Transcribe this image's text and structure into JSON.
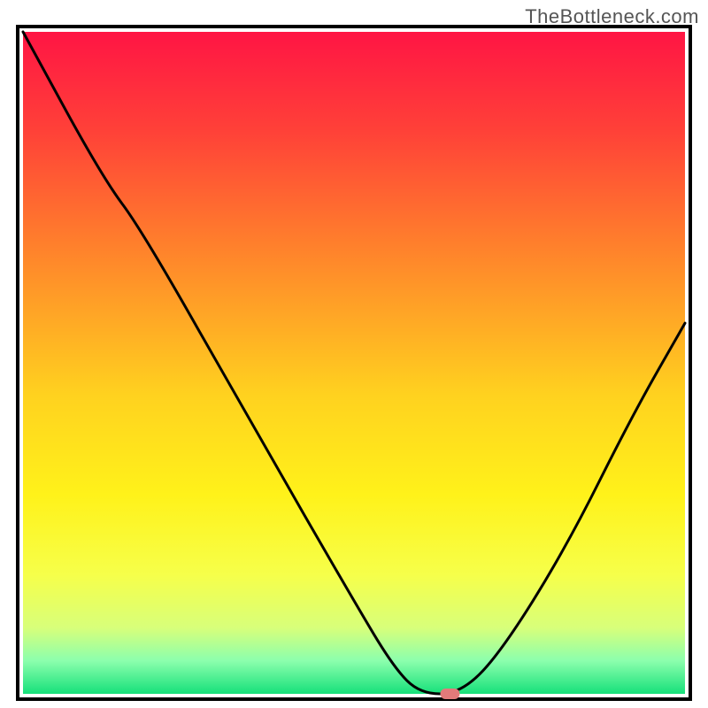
{
  "watermark": "TheBottleneck.com",
  "chart_data": {
    "type": "line",
    "title": "",
    "xlabel": "",
    "ylabel": "",
    "xlim": [
      0,
      100
    ],
    "ylim": [
      0,
      100
    ],
    "gradient_stops": [
      {
        "pct": 0,
        "color": "#ff1544"
      },
      {
        "pct": 15,
        "color": "#ff4138"
      },
      {
        "pct": 35,
        "color": "#ff8a2a"
      },
      {
        "pct": 55,
        "color": "#ffd21f"
      },
      {
        "pct": 70,
        "color": "#fff21a"
      },
      {
        "pct": 82,
        "color": "#f6ff4a"
      },
      {
        "pct": 90,
        "color": "#d8ff7a"
      },
      {
        "pct": 95,
        "color": "#8cffad"
      },
      {
        "pct": 100,
        "color": "#16e07a"
      }
    ],
    "curve": [
      {
        "x": 0,
        "y": 100
      },
      {
        "x": 12,
        "y": 78
      },
      {
        "x": 18,
        "y": 70
      },
      {
        "x": 35,
        "y": 40
      },
      {
        "x": 50,
        "y": 14
      },
      {
        "x": 56,
        "y": 4
      },
      {
        "x": 60,
        "y": 0
      },
      {
        "x": 66,
        "y": 0
      },
      {
        "x": 72,
        "y": 6
      },
      {
        "x": 82,
        "y": 22
      },
      {
        "x": 92,
        "y": 42
      },
      {
        "x": 100,
        "y": 56
      }
    ],
    "marker": {
      "x": 64.5,
      "y": 0
    },
    "marker_color": "#e27a7a"
  },
  "plot": {
    "outer_x": 20,
    "outer_y": 30,
    "outer_w": 760,
    "outer_h": 760,
    "pad_left": 6,
    "pad_right": 6,
    "pad_top": 6,
    "pad_bottom": 6
  }
}
